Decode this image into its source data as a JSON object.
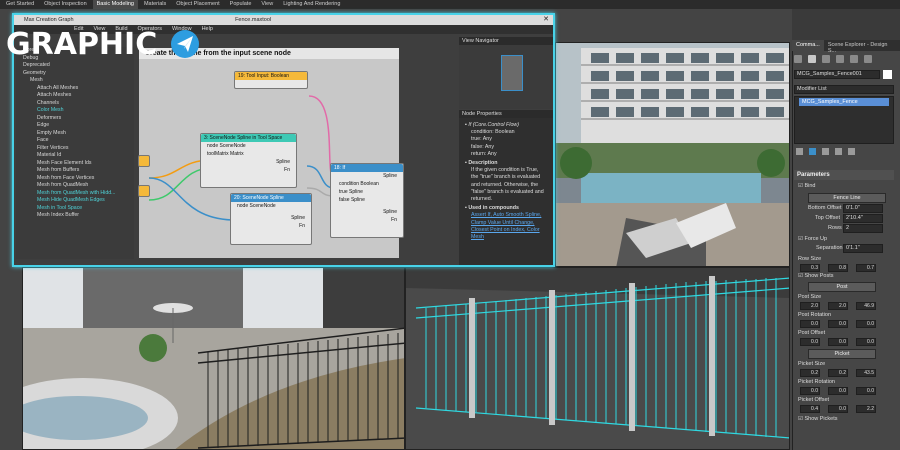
{
  "ribbon": {
    "tabs": [
      "Get Started",
      "Object Inspection",
      "Basic Modeling",
      "Materials",
      "Object Placement",
      "Populate",
      "View",
      "Lighting And Rendering"
    ],
    "active_tab": "Basic Modeling"
  },
  "mcg": {
    "title": "Max Creation Graph",
    "file": "Fence.maxtool",
    "menu": [
      "Edit",
      "View",
      "Build",
      "Operators",
      "Window",
      "Help"
    ],
    "graph_header": "Create the spline from the input scene node",
    "tree": [
      {
        "label": "Core",
        "indent": 1,
        "color": "normal"
      },
      {
        "label": "Debug",
        "indent": 1,
        "color": "normal"
      },
      {
        "label": "Deprecated",
        "indent": 1,
        "color": "normal"
      },
      {
        "label": "Geometry",
        "indent": 1,
        "color": "normal"
      },
      {
        "label": "Mesh",
        "indent": 2,
        "color": "normal"
      },
      {
        "label": "Attach All Meshes",
        "indent": 3,
        "color": "normal"
      },
      {
        "label": "Attach Meshes",
        "indent": 3,
        "color": "normal"
      },
      {
        "label": "Channels",
        "indent": 3,
        "color": "normal"
      },
      {
        "label": "Color Mesh",
        "indent": 3,
        "color": "cyan"
      },
      {
        "label": "Deformers",
        "indent": 3,
        "color": "normal"
      },
      {
        "label": "Edge",
        "indent": 3,
        "color": "normal"
      },
      {
        "label": "Empty Mesh",
        "indent": 3,
        "color": "normal"
      },
      {
        "label": "Face",
        "indent": 3,
        "color": "normal"
      },
      {
        "label": "Filter Vertices",
        "indent": 3,
        "color": "normal"
      },
      {
        "label": "Material Id",
        "indent": 3,
        "color": "normal"
      },
      {
        "label": "Mesh Face Element Ids",
        "indent": 3,
        "color": "normal"
      },
      {
        "label": "Mesh from Buffers",
        "indent": 3,
        "color": "normal"
      },
      {
        "label": "Mesh from Face Vertices",
        "indent": 3,
        "color": "normal"
      },
      {
        "label": "Mesh from QuadMesh",
        "indent": 3,
        "color": "normal"
      },
      {
        "label": "Mesh from QuadMesh with Hidd...",
        "indent": 3,
        "color": "cyan"
      },
      {
        "label": "Mesh Hide QuadMesh Edges",
        "indent": 3,
        "color": "cyan"
      },
      {
        "label": "Mesh in Tool Space",
        "indent": 3,
        "color": "cyan"
      },
      {
        "label": "Mesh Index Buffer",
        "indent": 3,
        "color": "normal"
      }
    ],
    "nodes": {
      "tool_input": "19: Tool Input: Boolean",
      "scenenode_spline": "3: SceneNode Spline in Tool Space",
      "scenenode_spline2": "20: SceneNode Spline",
      "if_node": "18: If",
      "ports": {
        "node": "node SceneNode",
        "matrix": "toolMatrix Matrix",
        "spline": "Spline",
        "fn": "Fn",
        "condition": "condition Boolean",
        "true": "true Spline",
        "false": "false Spline"
      }
    },
    "navigator_title": "View Navigator",
    "props_title": "Node Properties",
    "props": {
      "header": "If (Core.Control Flow)",
      "lines": [
        "condition: Boolean",
        "true: Any",
        "false: Any",
        "return: Any"
      ],
      "desc_title": "Description",
      "desc": "If the given condition is True, the \"true\" branch is evaluated and returned. Otherwise, the \"false\" branch is evaluated and returned.",
      "used_title": "Used in compounds",
      "used": "Assert If, Auto Smooth Spline, Clamp Value Until Change, Closest Point on Index, Color Mesh"
    }
  },
  "logo": {
    "text": "GRAPHIC"
  },
  "cmd_panel": {
    "tabs": [
      "Comma...",
      "Scene Explorer - Design S..."
    ],
    "object_name": "MCG_Samples_Fence001",
    "modifier_list": "Modifier List",
    "stack_item": "MCG_Samples_Fence",
    "rollout": "Parameters",
    "bind": "Bind",
    "fence_line_btn": "Fence Line",
    "bottom_offset_label": "Bottom Offset",
    "bottom_offset": "0'1.0\"",
    "top_offset_label": "Top Offset",
    "top_offset": "2'10.4\"",
    "rows_label": "Rows",
    "rows": "2",
    "force_up": "Force Up",
    "separation_label": "Separation",
    "separation": "0'1.1\"",
    "row_size_label": "Row Size",
    "row_size": [
      "0.3",
      "0.8",
      "0.7"
    ],
    "show_posts": "Show Posts",
    "post_btn": "Post",
    "post_size_label": "Post Size",
    "post_size": [
      "2.0",
      "2.0",
      "46.9"
    ],
    "post_rotation_label": "Post Rotation",
    "post_rotation": [
      "0.0",
      "0.0",
      "0.0"
    ],
    "post_offset_label": "Post Offset",
    "post_offset": [
      "0.0",
      "0.0",
      "0.0"
    ],
    "picket_btn": "Picket",
    "picket_size_label": "Picket Size",
    "picket_size": [
      "0.2",
      "0.2",
      "43.5"
    ],
    "picket_rotation_label": "Picket Rotation",
    "picket_rotation": [
      "0.0",
      "0.0",
      "0.0"
    ],
    "picket_offset_label": "Picket Offset",
    "picket_offset": [
      "0.4",
      "0.0",
      "2.2"
    ],
    "show_pickets": "Show Pickets"
  },
  "colors": {
    "accent": "#48d2e8",
    "node_green": "#3ec9b5",
    "node_blue": "#3b8fc9",
    "node_yellow": "#f5b93a"
  }
}
